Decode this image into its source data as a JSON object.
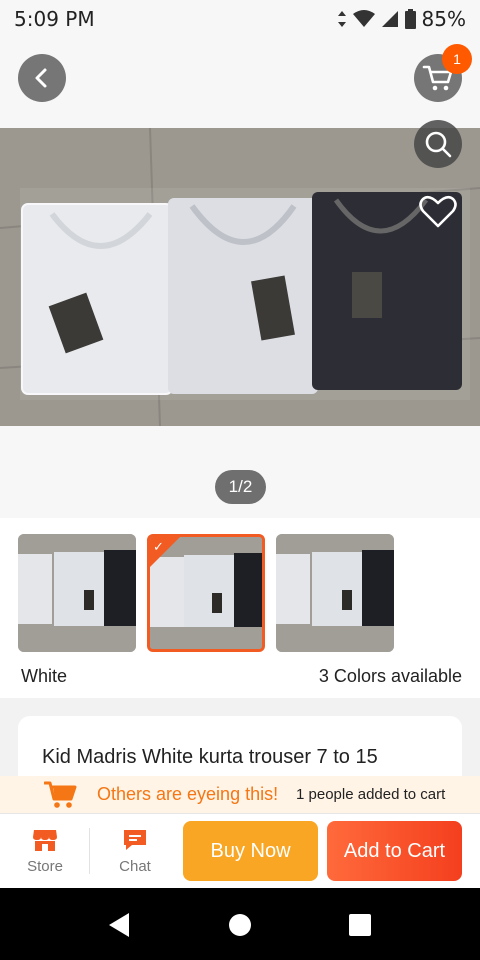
{
  "status": {
    "time": "5:09 PM",
    "battery": "85%"
  },
  "header": {
    "cart_count": "1"
  },
  "gallery": {
    "page_indicator": "1/2"
  },
  "variants": {
    "selected_name": "White",
    "colors_available": "3 Colors available"
  },
  "product": {
    "title": "Kid Madris White kurta trouser 7 to 15"
  },
  "notice": {
    "headline": "Others are eyeing this!",
    "detail": "1 people added to cart"
  },
  "actions": {
    "store_label": "Store",
    "chat_label": "Chat",
    "buy_now_label": "Buy Now",
    "add_to_cart_label": "Add to Cart"
  },
  "colors": {
    "accent": "#f25c23",
    "buy_now": "#f8a623",
    "add_to_cart": "#f43f1e",
    "notice_text": "#f57614"
  },
  "icons": [
    "back-icon",
    "cart-icon",
    "search-icon",
    "heart-icon",
    "store-icon",
    "chat-icon",
    "nav-back-icon",
    "nav-home-icon",
    "nav-recents-icon"
  ]
}
